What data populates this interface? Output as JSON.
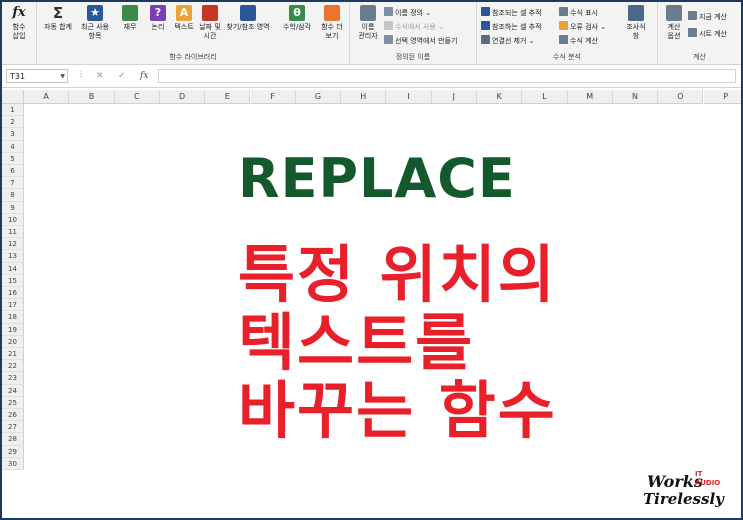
{
  "ribbon": {
    "insert_function": {
      "icon": "fx",
      "label_line1": "함수",
      "label_line2": "삽입"
    },
    "library": {
      "group_label": "함수 라이브러리",
      "autosum": {
        "icon": "Σ",
        "label": "자동 합계"
      },
      "recent": {
        "icon": "★",
        "label_line1": "최근 사용",
        "label_line2": "항목"
      },
      "financial": {
        "label": "재무"
      },
      "logical": {
        "icon": "?",
        "label": "논리"
      },
      "text": {
        "icon": "A",
        "label": "텍스트"
      },
      "datetime": {
        "label_line1": "날짜 및",
        "label_line2": "시간"
      },
      "lookup": {
        "label": "찾기/참조 영역"
      },
      "math": {
        "icon": "θ",
        "label": "수학/삼각"
      },
      "more": {
        "label_line1": "함수 더",
        "label_line2": "보기"
      }
    },
    "names": {
      "group_label": "정의된 이름",
      "name_manager_line1": "이름",
      "name_manager_line2": "관리자",
      "define_name": "이름 정의",
      "use_in_formula": "수식에서 사용",
      "create_from_selection": "선택 영역에서 만들기"
    },
    "auditing": {
      "group_label": "수식 분석",
      "trace_precedents": "참조되는 셀 추적",
      "trace_dependents": "참조하는 셀 추적",
      "remove_arrows": "연결선 제거",
      "show_formulas": "수식 표시",
      "error_checking": "오류 검사",
      "evaluate_formula": "수식 계산",
      "watch_line1": "조사식",
      "watch_line2": "창"
    },
    "calculation": {
      "group_label": "계산",
      "options_line1": "계산",
      "options_line2": "옵션",
      "calc_now": "지금 계산",
      "calc_sheet": "시트 계산"
    }
  },
  "formula_bar": {
    "name_box": "T31",
    "fx": "fx",
    "cancel": "✕",
    "enter": "✓",
    "value": ""
  },
  "columns": [
    "A",
    "B",
    "C",
    "D",
    "E",
    "F",
    "G",
    "H",
    "I",
    "J",
    "K",
    "L",
    "M",
    "N",
    "O",
    "P"
  ],
  "rows": [
    "1",
    "2",
    "3",
    "4",
    "5",
    "6",
    "7",
    "8",
    "9",
    "10",
    "11",
    "12",
    "13",
    "14",
    "15",
    "16",
    "17",
    "18",
    "19",
    "20",
    "21",
    "22",
    "23",
    "24",
    "25",
    "26",
    "27",
    "28",
    "29",
    "30"
  ],
  "content": {
    "title": "REPLACE",
    "line1": "특정 위치의",
    "line2": "텍스트를",
    "line3": "바꾸는 함수"
  },
  "logo": {
    "works": "Works",
    "it": "IT",
    "audio": "AUDIO",
    "tirelessly": "Tirelessly"
  },
  "colors": {
    "title_green": "#13592c",
    "korean_red": "#e8202a",
    "frame_navy": "#1e3a5f"
  }
}
